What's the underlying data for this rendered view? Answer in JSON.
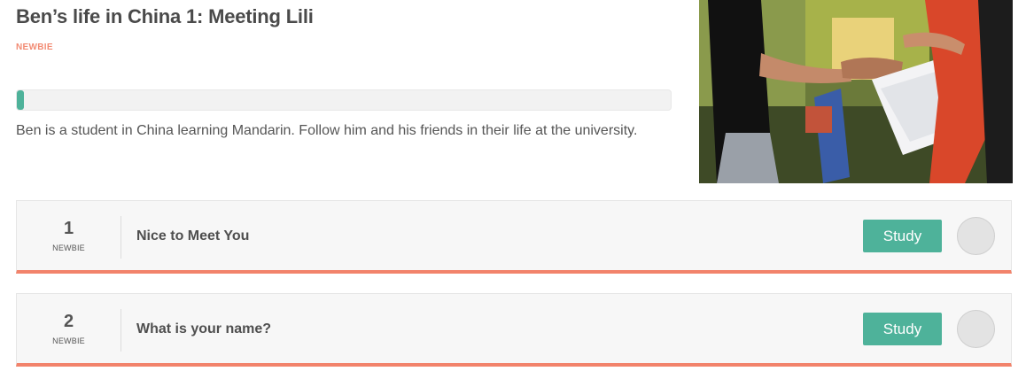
{
  "course": {
    "title": "Ben’s life in China 1: Meeting Lili",
    "level": "NEWBIE",
    "progress_fraction": 0.01,
    "description": "Ben is a student in China learning Mandarin. Follow him and his friends in their life at the university."
  },
  "lessons": [
    {
      "number": "1",
      "level": "NEWBIE",
      "title": "Nice to Meet You",
      "study_label": "Study"
    },
    {
      "number": "2",
      "level": "NEWBIE",
      "title": "What is your name?",
      "study_label": "Study"
    }
  ],
  "colors": {
    "accent": "#4eb29a",
    "level_text": "#f28b73",
    "lesson_border": "#f2836b"
  }
}
